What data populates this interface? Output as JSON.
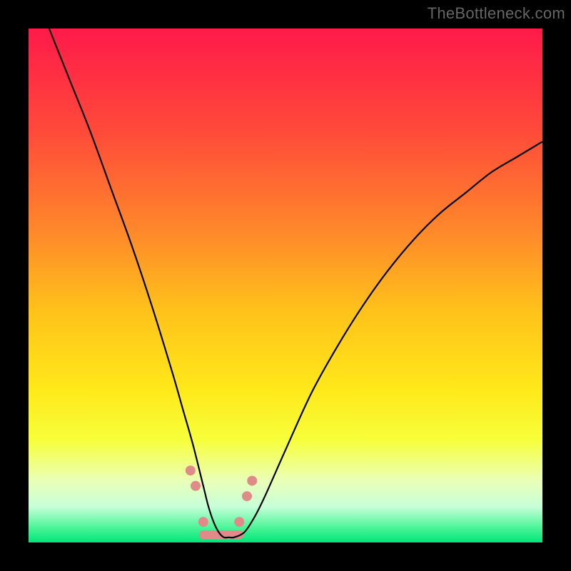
{
  "watermark": "TheBottleneck.com",
  "chart_data": {
    "type": "line",
    "title": "",
    "xlabel": "",
    "ylabel": "",
    "xlim": [
      0,
      100
    ],
    "ylim": [
      0,
      100
    ],
    "grid": false,
    "background_gradient": {
      "stops": [
        {
          "pos": 0.0,
          "color": "#ff1a4a"
        },
        {
          "pos": 0.2,
          "color": "#ff4a3a"
        },
        {
          "pos": 0.4,
          "color": "#ff8a2a"
        },
        {
          "pos": 0.55,
          "color": "#ffc21a"
        },
        {
          "pos": 0.7,
          "color": "#ffe81a"
        },
        {
          "pos": 0.8,
          "color": "#f7ff3a"
        },
        {
          "pos": 0.88,
          "color": "#eaffb8"
        },
        {
          "pos": 0.93,
          "color": "#c8ffd8"
        },
        {
          "pos": 0.97,
          "color": "#50f59a"
        },
        {
          "pos": 1.0,
          "color": "#00e57a"
        }
      ]
    },
    "series": [
      {
        "name": "bottleneck_curve",
        "stroke": "#000000",
        "x": [
          4,
          8,
          12,
          16,
          20,
          24,
          28,
          30,
          32,
          34,
          35,
          36,
          37,
          38,
          39,
          40,
          42,
          44,
          46,
          50,
          55,
          60,
          65,
          70,
          75,
          80,
          85,
          90,
          95,
          100
        ],
        "y": [
          100,
          90,
          80,
          69,
          58,
          46,
          33,
          26,
          19,
          11,
          7,
          4,
          2,
          1,
          1,
          1,
          2,
          5,
          9,
          18,
          29,
          38,
          46,
          53,
          59,
          64,
          68,
          72,
          75,
          78
        ]
      }
    ],
    "min_marker": {
      "color": "#e08a8a",
      "x_range": [
        31,
        44
      ],
      "dots": [
        {
          "x": 31.5,
          "y": 14
        },
        {
          "x": 32.5,
          "y": 11
        },
        {
          "x": 34.0,
          "y": 4
        },
        {
          "x": 41.0,
          "y": 4
        },
        {
          "x": 42.5,
          "y": 9
        },
        {
          "x": 43.5,
          "y": 12
        }
      ],
      "bar": {
        "x0": 34,
        "x1": 41,
        "y": 1.5
      }
    }
  }
}
